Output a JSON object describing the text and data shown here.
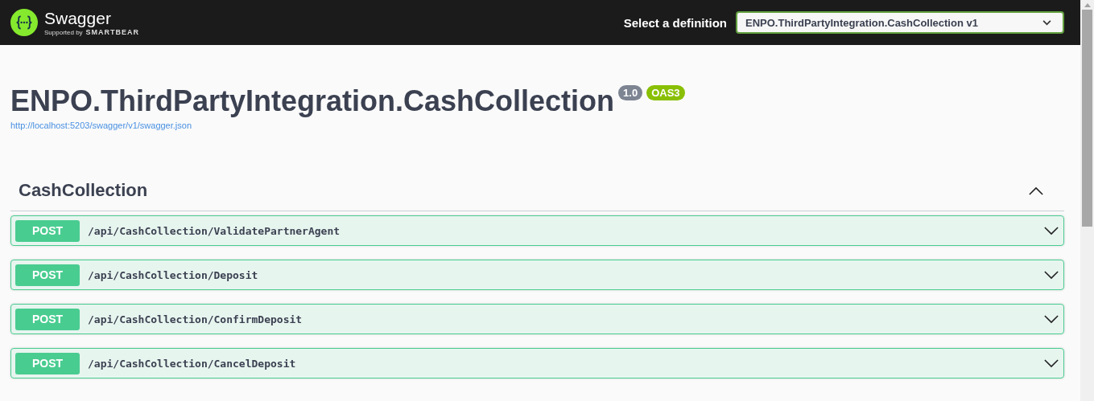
{
  "topbar": {
    "logo_name": "Swagger",
    "tagline": "Supported by",
    "brand": "SMARTBEAR",
    "definition_label": "Select a definition",
    "definition_value": "ENPO.ThirdPartyIntegration.CashCollection v1"
  },
  "info": {
    "title": "ENPO.ThirdPartyIntegration.CashCollection",
    "version": "1.0",
    "spec": "OAS3",
    "url": "http://localhost:5203/swagger/v1/swagger.json"
  },
  "tag": {
    "name": "CashCollection",
    "expanded": true
  },
  "operations": [
    {
      "method": "POST",
      "path": "/api/CashCollection/ValidatePartnerAgent",
      "expanded": false
    },
    {
      "method": "POST",
      "path": "/api/CashCollection/Deposit",
      "expanded": false
    },
    {
      "method": "POST",
      "path": "/api/CashCollection/ConfirmDeposit",
      "expanded": false
    },
    {
      "method": "POST",
      "path": "/api/CashCollection/CancelDeposit",
      "expanded": false
    }
  ]
}
